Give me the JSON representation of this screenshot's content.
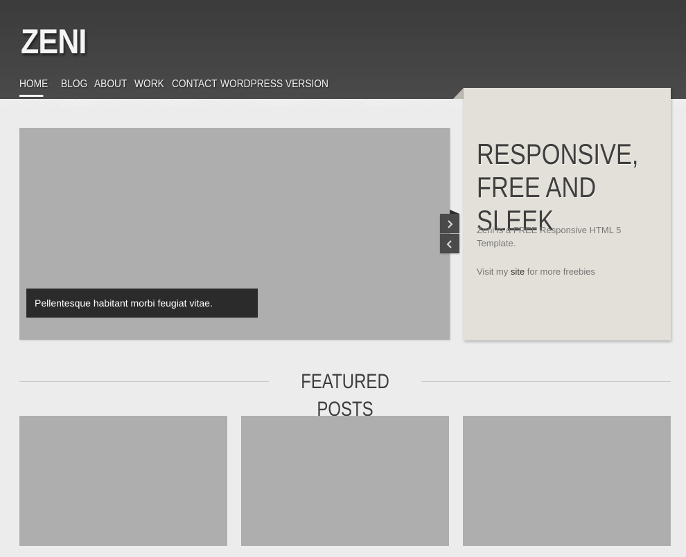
{
  "site": {
    "logo": "ZENI"
  },
  "nav": [
    {
      "label": "HOME",
      "active": true
    },
    {
      "label": "BLOG",
      "active": false
    },
    {
      "label": "ABOUT",
      "active": false
    },
    {
      "label": "WORK",
      "active": false
    },
    {
      "label": "CONTACT",
      "active": false
    },
    {
      "label": "WORDPRESS VERSION",
      "active": false
    }
  ],
  "slider": {
    "caption": "Pellentesque habitant morbi feugiat vitae.",
    "next_icon": "chevron-right-icon",
    "prev_icon": "chevron-left-icon"
  },
  "panel": {
    "title": "RESPONSIVE, FREE AND SLEEK",
    "text": "Zeni is a FREE Responsive HTML 5 Template.",
    "visit_prefix": "Visit my ",
    "visit_link": "site",
    "visit_suffix": " for more freebies"
  },
  "featured": {
    "title": "FEATURED POSTS"
  },
  "colors": {
    "header": "#404040",
    "background": "#ececec",
    "panel": "#e3e0d9",
    "placeholder": "#afaeaf",
    "caption": "#2b2b2b"
  }
}
